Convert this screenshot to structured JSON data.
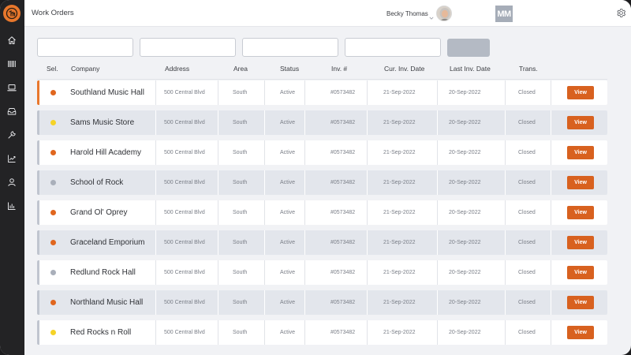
{
  "header": {
    "title": "Work Orders",
    "user_name": "Becky Thomas",
    "badge": "MM"
  },
  "colors": {
    "accent": "#e8772c",
    "view_button": "#d8611f",
    "status_orange": "#e0661e",
    "status_yellow": "#f5d327",
    "status_gray": "#a9afba"
  },
  "sidebar": {
    "icons": [
      "logo-icon",
      "home-icon",
      "barcode-icon",
      "laptop-icon",
      "inbox-icon",
      "wrench-icon",
      "trend-chart-icon",
      "user-icon",
      "bar-chart-icon"
    ]
  },
  "table": {
    "columns": [
      "Sel.",
      "Company",
      "Address",
      "Area",
      "Status",
      "Inv. #",
      "Cur. Inv. Date",
      "Last Inv. Date",
      "Trans."
    ],
    "rows": [
      {
        "dot": "orange",
        "company": "Southland Music Hall",
        "address": "500 Central Blvd",
        "area": "South",
        "status": "Active",
        "inv": "#0573482",
        "cur_date": "21-Sep-2022",
        "last_date": "20-Sep-2022",
        "trans": "Closed",
        "action": "View"
      },
      {
        "dot": "yellow",
        "company": "Sams Music Store",
        "address": "500 Central Blvd",
        "area": "South",
        "status": "Active",
        "inv": "#0573482",
        "cur_date": "21-Sep-2022",
        "last_date": "20-Sep-2022",
        "trans": "Closed",
        "action": "View"
      },
      {
        "dot": "orange",
        "company": "Harold Hill Academy",
        "address": "500 Central Blvd",
        "area": "South",
        "status": "Active",
        "inv": "#0573482",
        "cur_date": "21-Sep-2022",
        "last_date": "20-Sep-2022",
        "trans": "Closed",
        "action": "View"
      },
      {
        "dot": "gray",
        "company": "School of Rock",
        "address": "500 Central Blvd",
        "area": "South",
        "status": "Active",
        "inv": "#0573482",
        "cur_date": "21-Sep-2022",
        "last_date": "20-Sep-2022",
        "trans": "Closed",
        "action": "View"
      },
      {
        "dot": "orange",
        "company": "Grand Ol' Oprey",
        "address": "500 Central Blvd",
        "area": "South",
        "status": "Active",
        "inv": "#0573482",
        "cur_date": "21-Sep-2022",
        "last_date": "20-Sep-2022",
        "trans": "Closed",
        "action": "View"
      },
      {
        "dot": "orange",
        "company": "Graceland Emporium",
        "address": "500 Central Blvd",
        "area": "South",
        "status": "Active",
        "inv": "#0573482",
        "cur_date": "21-Sep-2022",
        "last_date": "20-Sep-2022",
        "trans": "Closed",
        "action": "View"
      },
      {
        "dot": "gray",
        "company": "Redlund Rock Hall",
        "address": "500 Central Blvd",
        "area": "South",
        "status": "Active",
        "inv": "#0573482",
        "cur_date": "21-Sep-2022",
        "last_date": "20-Sep-2022",
        "trans": "Closed",
        "action": "View"
      },
      {
        "dot": "orange",
        "company": "Northland Music Hall",
        "address": "500 Central Blvd",
        "area": "South",
        "status": "Active",
        "inv": "#0573482",
        "cur_date": "21-Sep-2022",
        "last_date": "20-Sep-2022",
        "trans": "Closed",
        "action": "View"
      },
      {
        "dot": "yellow",
        "company": "Red Rocks n Roll",
        "address": "500 Central Blvd",
        "area": "South",
        "status": "Active",
        "inv": "#0573482",
        "cur_date": "21-Sep-2022",
        "last_date": "20-Sep-2022",
        "trans": "Closed",
        "action": "View"
      }
    ]
  }
}
